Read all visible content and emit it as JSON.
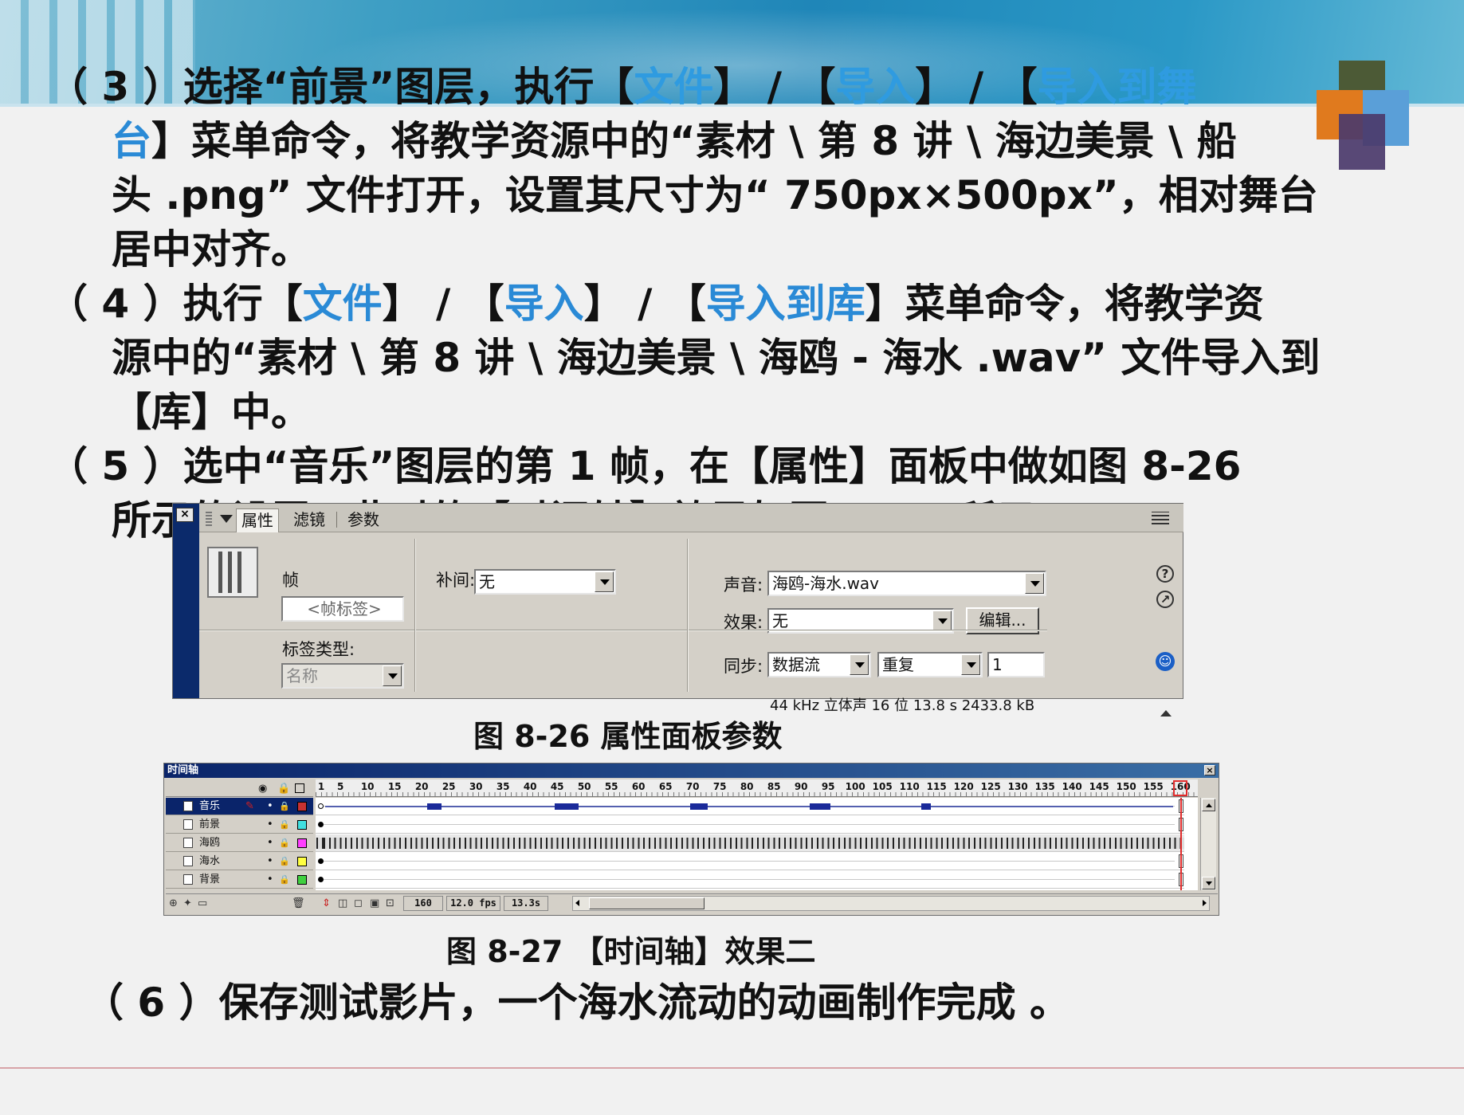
{
  "slide": {
    "step3": {
      "number": "（ 3 ）",
      "line1_a": "选择“前景”图层，执行【",
      "menu_file": "文件",
      "sep1": "】 / 【",
      "menu_import": "导入",
      "sep2": "】 / 【",
      "menu_import_stage_a": "导入到舞",
      "line2_menu_b": "台",
      "line2_rest": "】菜单命令，将教学资源中的“素材 \\ 第 8 讲 \\ 海边美景 \\ 船",
      "line3": "头 .png” 文件打开，设置其尺寸为“ 750px×500px”，相对舞台",
      "line4": "居中对齐。"
    },
    "step4": {
      "number": "（ 4 ）",
      "line1_a": "执行【",
      "menu_file": "文件",
      "sep1": "】 / 【",
      "menu_import": "导入",
      "sep2": "】 / 【",
      "menu_import_lib": "导入到库",
      "line1_b": "】菜单命令，将教学资",
      "line2": "源中的“素材 \\ 第 8 讲 \\ 海边美景 \\ 海鸥 - 海水 .wav” 文件导入到",
      "line3": "【库】中。"
    },
    "step5": {
      "number": "（ 5 ）",
      "line1": "选中“音乐”图层的第 1 帧，在【属性】面板中做如图 8-26",
      "line2": "所示的设置，此时的【时间轴】效果如图 8-27 所示。"
    },
    "caption_8_26": "图 8-26    属性面板参数",
    "caption_8_27": "图 8-27    【时间轴】效果二",
    "step6": {
      "number": "（ 6 ）",
      "text": "保存测试影片，一个海水流动的动画制作完成 。"
    }
  },
  "properties_panel": {
    "tabs": [
      "属性",
      "滤镜",
      "参数"
    ],
    "frame_label": "帧",
    "frame_label_placeholder": "<帧标签>",
    "label_type_label": "标签类型:",
    "label_type_value": "名称",
    "tween_label": "补间:",
    "tween_value": "无",
    "sound_label": "声音:",
    "sound_value": "海鸥-海水.wav",
    "effect_label": "效果:",
    "effect_value": "无",
    "edit_button": "编辑...",
    "sync_label": "同步:",
    "sync_value": "数据流",
    "repeat_value": "重复",
    "repeat_count": "1",
    "sound_info": "44 kHz 立体声 16 位 13.8 s 2433.8 kB",
    "help_icon": "?",
    "jump_icon": "↗",
    "accessibility_icon": "accessibility-icon"
  },
  "timeline_panel": {
    "title": "时间轴",
    "close": "×",
    "ruler_numbers": [
      "1",
      "5",
      "10",
      "15",
      "20",
      "25",
      "30",
      "35",
      "40",
      "45",
      "50",
      "55",
      "60",
      "65",
      "70",
      "75",
      "80",
      "85",
      "90",
      "95",
      "100",
      "105",
      "110",
      "115",
      "120",
      "125",
      "130",
      "135",
      "140",
      "145",
      "150",
      "155",
      "160"
    ],
    "layers": [
      {
        "name": "音乐",
        "color": "#c83232",
        "selected": true
      },
      {
        "name": "前景",
        "color": "#40e0e0",
        "selected": false
      },
      {
        "name": "海鸥",
        "color": "#ff40ff",
        "selected": false
      },
      {
        "name": "海水",
        "color": "#ffff40",
        "selected": false
      },
      {
        "name": "背景",
        "color": "#40d040",
        "selected": false
      }
    ],
    "current_frame": "160",
    "frame_rate": "12.0 fps",
    "elapsed_time": "13.3s"
  }
}
